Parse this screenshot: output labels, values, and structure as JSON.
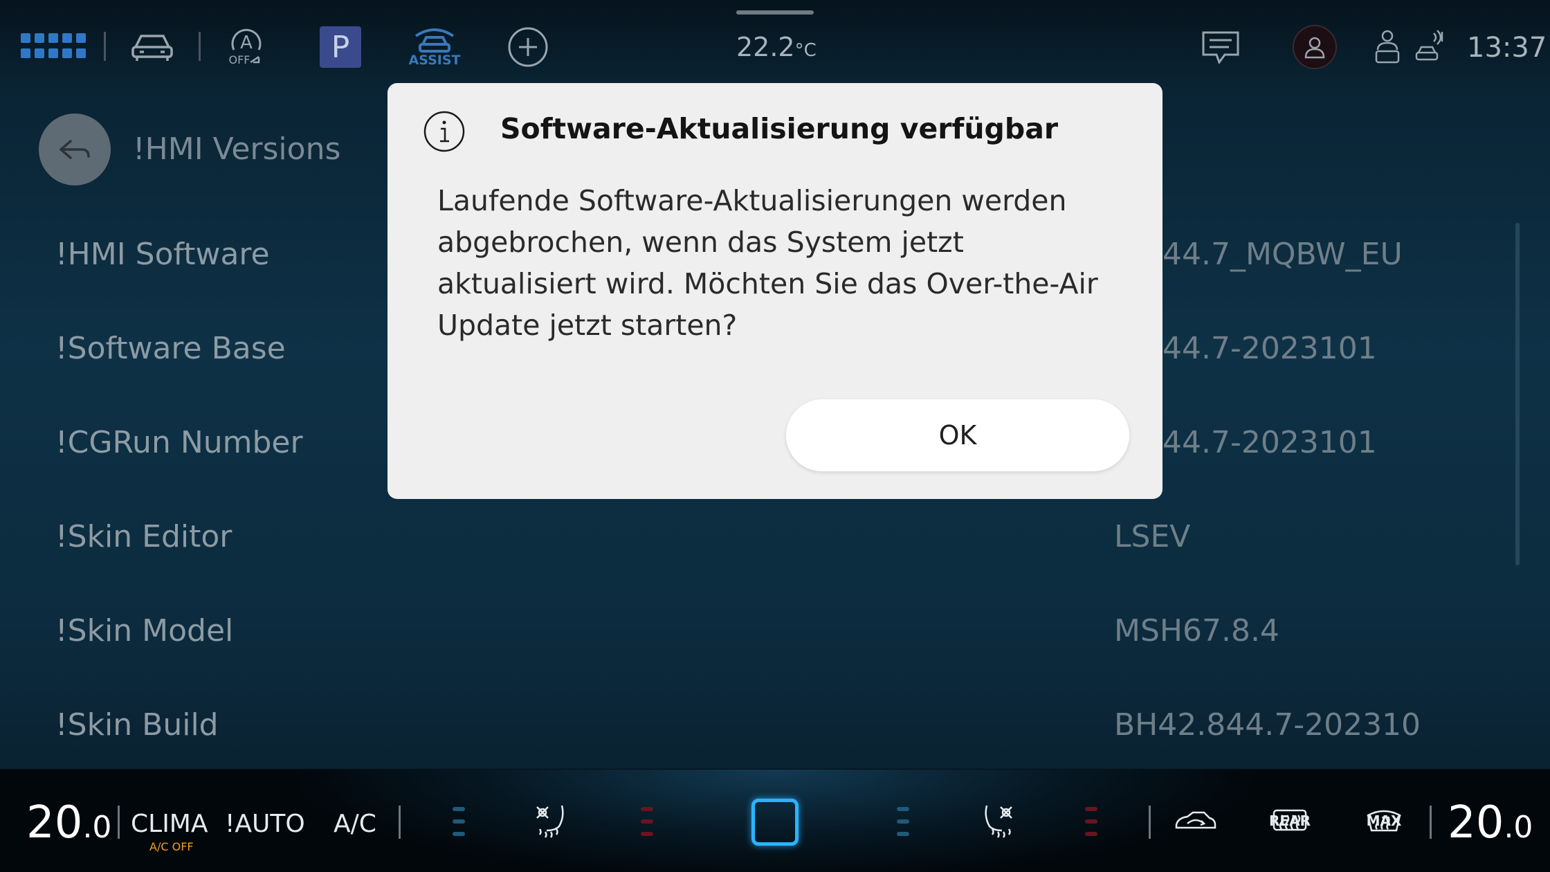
{
  "status_bar": {
    "outside_temp_value": "22.2",
    "outside_temp_unit": "°C",
    "clock": "13:37",
    "assist_label": "ASSIST",
    "auto_hold_label": "OFF",
    "parking_label": "P",
    "icons": [
      "apps-grid-icon",
      "car-icon",
      "auto-hold-icon",
      "parking-icon",
      "assist-car-icon",
      "add-icon",
      "message-icon",
      "profile-icon",
      "driver-icon",
      "connectivity-icon"
    ]
  },
  "page": {
    "title": "!HMI Versions",
    "rows": [
      {
        "label": "!HMI Software",
        "value": "2.844.7_MQBW_EU"
      },
      {
        "label": "!Software Base",
        "value": "2.844.7-2023101"
      },
      {
        "label": "!CGRun Number",
        "value": "2.844.7-2023101"
      },
      {
        "label": "!Skin Editor",
        "value": "LSEV"
      },
      {
        "label": "!Skin Model",
        "value": "MSH67.8.4"
      },
      {
        "label": "!Skin Build",
        "value": "BH42.844.7-202310"
      }
    ]
  },
  "dialog": {
    "title": "Software-Aktualisierung verfügbar",
    "body": "Laufende Software-Aktualisierungen werden abgebrochen, wenn das System jetzt aktualisiert wird. Möchten Sie das Over-the-Air Update jetzt starten?",
    "ok_label": "OK"
  },
  "climate": {
    "left_temp_int": "20",
    "left_temp_dec": ".0",
    "right_temp_int": "20",
    "right_temp_dec": ".0",
    "clima_label": "CLIMA",
    "ac_off_label": "A/C OFF",
    "auto_label": "!AUTO",
    "ac_label": "A/C",
    "rear_label": "REAR",
    "max_label": "MAX",
    "colors": {
      "accent": "#2ab4ff",
      "cool": "#1e5a7a",
      "warm": "#6a1420",
      "ac_off": "#f0a020"
    }
  }
}
